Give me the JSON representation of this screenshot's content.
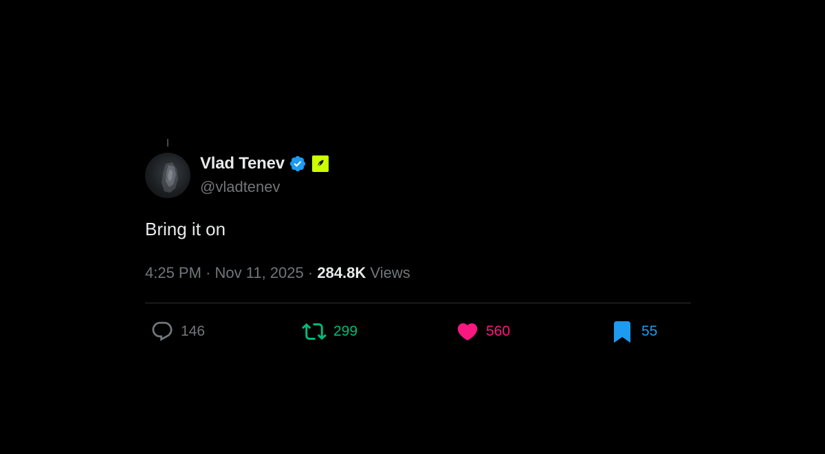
{
  "tweet": {
    "author": {
      "display_name": "Vlad Tenev",
      "handle": "@vladtenev",
      "verified": true,
      "affiliate_badge_color": "#ccff00"
    },
    "text": "Bring it on",
    "time": "4:25 PM",
    "separator": "·",
    "date": "Nov 11, 2025",
    "views_count": "284.8K",
    "views_label": "Views"
  },
  "actions": {
    "reply": {
      "icon": "reply-icon",
      "count": "146",
      "color": "#71767b"
    },
    "retweet": {
      "icon": "retweet-icon",
      "count": "299",
      "color": "#00ba7c"
    },
    "like": {
      "icon": "heart-icon",
      "count": "560",
      "color": "#f91880",
      "active": true
    },
    "bookmark": {
      "icon": "bookmark-icon",
      "count": "55",
      "color": "#1d9bf0",
      "active": true
    }
  },
  "colors": {
    "background": "#000000",
    "text_primary": "#e7e9ea",
    "text_secondary": "#71767b",
    "verified_blue": "#1d9bf0",
    "divider": "#2f3336"
  }
}
